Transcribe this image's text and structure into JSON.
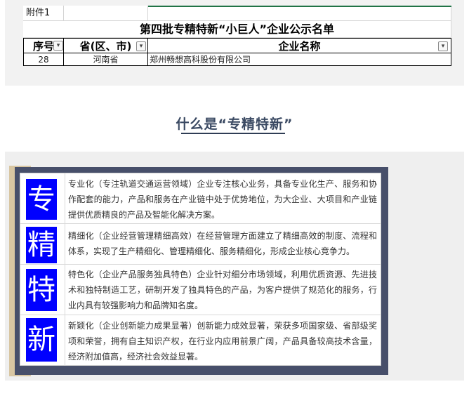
{
  "sheet": {
    "attachment_label": "附件1",
    "list_title": "第四批专精特新“小巨人”企业公示名单",
    "headers": {
      "index": "序号",
      "province": "省(区、市)",
      "company": "企业名称"
    },
    "row": {
      "index": "28",
      "province": "河南省",
      "company": "郑州畅想高科股份有限公司"
    }
  },
  "section_title": "什么是“专精特新”",
  "items": [
    {
      "char": "专",
      "text": "专业化（专注轨道交通运营领域）企业专注核心业务，具备专业化生产、服务和协作配套的能力，产品和服务在产业链中处于优势地位，为大企业、大项目和产业链提供优质精良的产品及智能化解决方案。"
    },
    {
      "char": "精",
      "text": "精细化（企业经营管理精细高效）在经营管理方面建立了精细高效的制度、流程和体系，实现了生产精细化、管理精细化、服务精细化，形成企业核心竞争力。"
    },
    {
      "char": "特",
      "text": "特色化（企业产品服务独具特色）企业针对细分市场领域，利用优质资源、先进技术和独特制造工艺，研制开发了独具特色的产品，为客户提供了规范化的服务，行业内具有较强影响力和品牌知名度。"
    },
    {
      "char": "新",
      "text": "新颖化（企业创新能力成果显著）创新能力成效显著，荣获多项国家级、省部级奖项和荣誉，拥有自主知识产权，在行业内应用前景广阔，产品具备较高技术含量，经济附加值高，经济社会效益显著。"
    }
  ],
  "colors": {
    "char_box": "#0000ff",
    "frame_navy": "#474f6a",
    "frame_gold": "#d8c6a2",
    "title_text": "#3b4a63"
  }
}
